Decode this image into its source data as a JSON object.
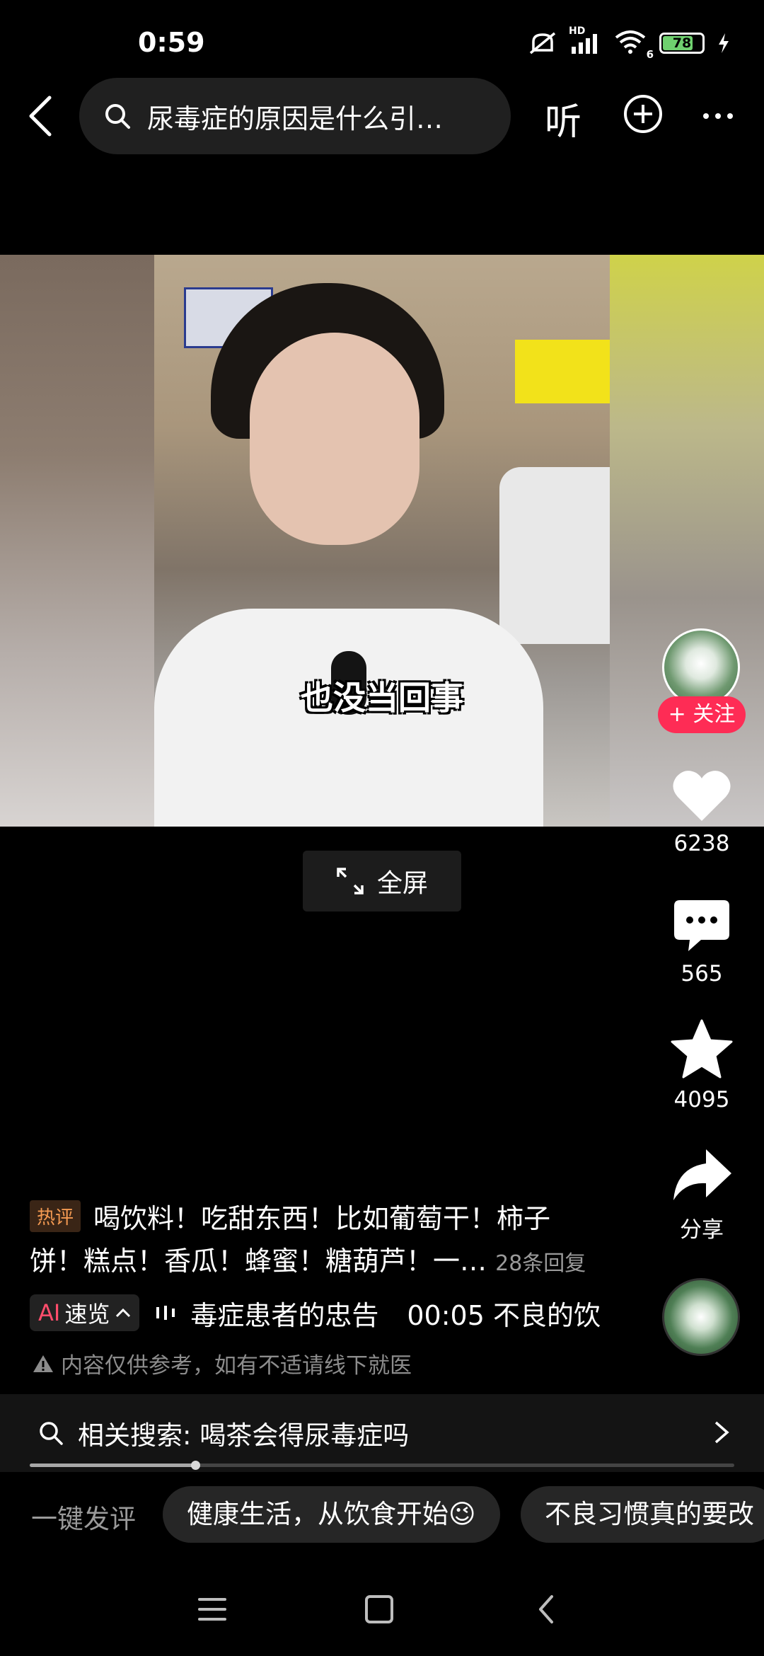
{
  "status_bar": {
    "time": "0:59",
    "battery": "78",
    "battery_level": 0.78,
    "network_badge": "HD",
    "wifi_badge": "6",
    "icons": [
      "mute-icon",
      "signal-icon",
      "wifi-icon",
      "battery-icon",
      "charging-icon"
    ]
  },
  "top_bar": {
    "search_query": "尿毒症的原因是什么引…",
    "listen_label": "听",
    "icons": [
      "back-icon",
      "search-icon",
      "add-circle-icon",
      "more-icon"
    ]
  },
  "video": {
    "caption": "也没当回事"
  },
  "fullscreen": {
    "label": "全屏"
  },
  "actions": {
    "follow_label": "+ 关注",
    "likes": "6238",
    "comments": "565",
    "favorites": "4095",
    "share_label": "分享"
  },
  "hot_comment": {
    "badge": "热评",
    "text": "喝饮料！吃甜东西！比如葡萄干！柿子饼！糕点！香瓜！蜂蜜！糖葫芦！一…",
    "replies": "28条回复"
  },
  "ai_summary": {
    "badge_ai": "AI",
    "badge_label": "速览",
    "transcript_part1": "毒症患者的忠告",
    "transcript_part2": "00:05 不良的饮"
  },
  "disclaimer": "内容仅供参考，如有不适请线下就医",
  "related_search": {
    "label": "相关搜索: 喝茶会得尿毒症吗"
  },
  "progress": {
    "fraction": 0.235
  },
  "quick_comment": {
    "label": "一键发评",
    "chips": [
      "健康生活，从饮食开始😉",
      "不良习惯真的要改"
    ]
  },
  "colors": {
    "accent": "#fe2c55",
    "hot_badge": "#f49a52",
    "battery_green": "#6fd16f"
  }
}
